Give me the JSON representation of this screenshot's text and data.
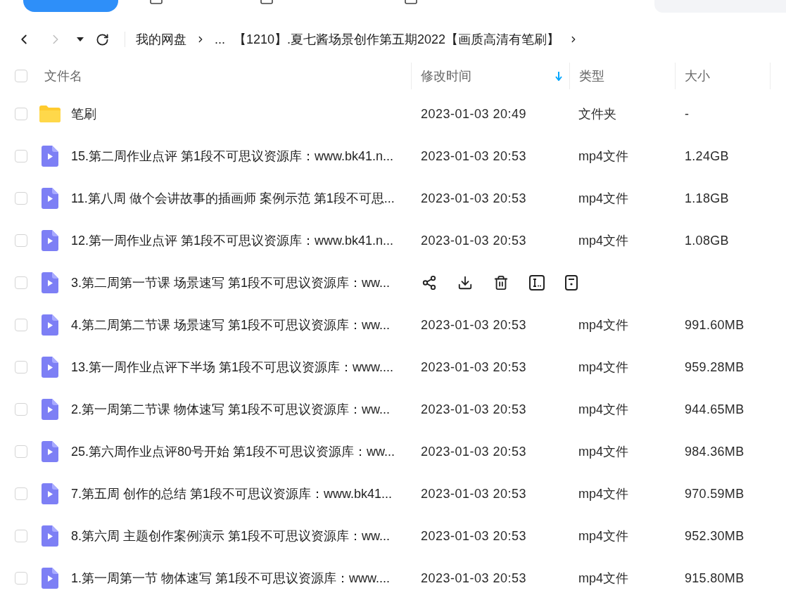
{
  "navigation": {
    "back_disabled": false,
    "forward_disabled": true
  },
  "breadcrumb": [
    {
      "label": "我的网盘",
      "separator": true
    },
    {
      "label": "...",
      "separator": false
    },
    {
      "label": "【1210】.夏七酱场景创作第五期2022【画质高清有笔刷】",
      "separator": true
    }
  ],
  "table": {
    "select_all": {
      "checked": false
    },
    "columns": [
      {
        "label": "文件名",
        "sorted": false
      },
      {
        "label": "修改时间",
        "sorted": true
      },
      {
        "label": "类型",
        "sorted": false
      },
      {
        "label": "大小",
        "sorted": false
      }
    ],
    "rows": [
      {
        "kind": "folder",
        "name": "笔刷",
        "modified": "2023-01-03 20:49",
        "type": "文件夹",
        "size": "-",
        "checked": false,
        "hovered": false
      },
      {
        "kind": "video",
        "name": "15.第二周作业点评 第1段不可思议资源库：www.bk41.n...",
        "modified": "2023-01-03 20:53",
        "type": "mp4文件",
        "size": "1.24GB",
        "checked": false,
        "hovered": false
      },
      {
        "kind": "video",
        "name": "11.第八周 做个会讲故事的插画师 案例示范 第1段不可思...",
        "modified": "2023-01-03 20:53",
        "type": "mp4文件",
        "size": "1.18GB",
        "checked": false,
        "hovered": false
      },
      {
        "kind": "video",
        "name": "12.第一周作业点评 第1段不可思议资源库：www.bk41.n...",
        "modified": "2023-01-03 20:53",
        "type": "mp4文件",
        "size": "1.08GB",
        "checked": false,
        "hovered": false
      },
      {
        "kind": "video",
        "name": "3.第二周第一节课 场景速写 第1段不可思议资源库：ww...",
        "checked": false,
        "hovered": true
      },
      {
        "kind": "video",
        "name": "4.第二周第二节课 场景速写 第1段不可思议资源库：ww...",
        "modified": "2023-01-03 20:53",
        "type": "mp4文件",
        "size": "991.60MB",
        "checked": false,
        "hovered": false
      },
      {
        "kind": "video",
        "name": "13.第一周作业点评下半场 第1段不可思议资源库：www....",
        "modified": "2023-01-03 20:53",
        "type": "mp4文件",
        "size": "959.28MB",
        "checked": false,
        "hovered": false
      },
      {
        "kind": "video",
        "name": "2.第一周第二节课 物体速写 第1段不可思议资源库：ww...",
        "modified": "2023-01-03 20:53",
        "type": "mp4文件",
        "size": "944.65MB",
        "checked": false,
        "hovered": false
      },
      {
        "kind": "video",
        "name": "25.第六周作业点评80号开始 第1段不可思议资源库：ww...",
        "modified": "2023-01-03 20:53",
        "type": "mp4文件",
        "size": "984.36MB",
        "checked": false,
        "hovered": false
      },
      {
        "kind": "video",
        "name": "7.第五周 创作的总结 第1段不可思议资源库：www.bk41...",
        "modified": "2023-01-03 20:53",
        "type": "mp4文件",
        "size": "970.59MB",
        "checked": false,
        "hovered": false
      },
      {
        "kind": "video",
        "name": "8.第六周 主题创作案例演示 第1段不可思议资源库：ww...",
        "modified": "2023-01-03 20:53",
        "type": "mp4文件",
        "size": "952.30MB",
        "checked": false,
        "hovered": false
      },
      {
        "kind": "video",
        "name": "1.第一周第一节 物体速写 第1段不可思议资源库：www....",
        "modified": "2023-01-03 20:53",
        "type": "mp4文件",
        "size": "915.80MB",
        "checked": false,
        "hovered": false
      }
    ]
  }
}
